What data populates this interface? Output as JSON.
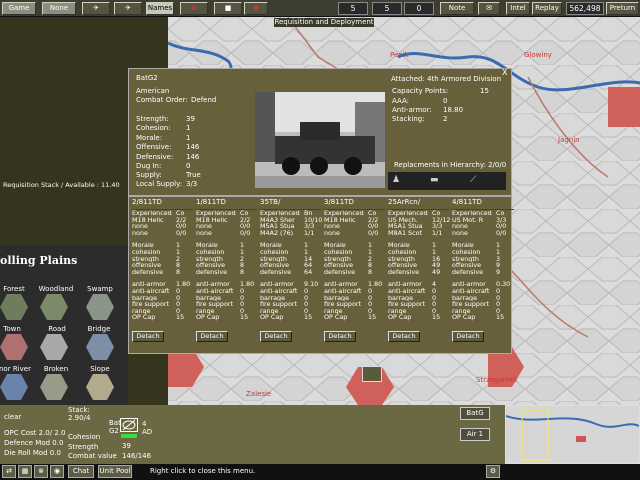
{
  "topbar": {
    "game": "Game",
    "none": "None",
    "names": "Names",
    "note": "Note",
    "intel": "Intel",
    "replay": "Replay",
    "score": "562,498",
    "preturn": "Preturn",
    "unit_count_1": "5",
    "unit_count_2": "5",
    "unit_count_3": "0"
  },
  "requisition": {
    "title": "Requisition and Deployment",
    "stack": "Requisition  Stack / Available : 11.40"
  },
  "map": {
    "towns": [
      "Penik",
      "Glowiny",
      "Jagnin",
      "Zalesie",
      "Strzegomek"
    ]
  },
  "info": {
    "unit": "BatG2",
    "nation": "American",
    "combat_order_label": "Combat Order:",
    "combat_order": "Defend",
    "stats": [
      {
        "label": "Strength:",
        "value": "39"
      },
      {
        "label": "Cohesion:",
        "value": "1"
      },
      {
        "label": "Morale:",
        "value": "1"
      },
      {
        "label": "Offensive:",
        "value": "146"
      },
      {
        "label": "Defensive:",
        "value": "146"
      },
      {
        "label": "Dug In:",
        "value": "0"
      },
      {
        "label": "Supply:",
        "value": "True"
      },
      {
        "label": "Local Supply:",
        "value": "3/3"
      }
    ],
    "attached": "Attached: 4th Armored Division",
    "right_stats": [
      {
        "label": "Capacity Points:",
        "value": "15"
      },
      {
        "label": "AAA:",
        "value": "0"
      },
      {
        "label": "Anti-armor:",
        "value": "18.80"
      },
      {
        "label": "Stacking:",
        "value": "2"
      }
    ],
    "replacements": "Replacments in Hierarchy: 2/0/0",
    "close": "X"
  },
  "units": [
    {
      "name": "2/811TD",
      "co_h": "Co",
      "eq": [
        [
          "Experienced",
          "Co"
        ],
        [
          "M18 Hellc",
          "2/2"
        ],
        [
          "none",
          "0/0"
        ],
        [
          "none",
          "0/0"
        ]
      ],
      "st": [
        [
          "Morale",
          "1"
        ],
        [
          "cohesion",
          "1"
        ],
        [
          "strength",
          "2"
        ],
        [
          "offensive",
          "8"
        ],
        [
          "defensive",
          "8"
        ]
      ],
      "cb": [
        [
          "anti-armor",
          "1.80"
        ],
        [
          "anti-aircraft",
          "0"
        ],
        [
          "barrage",
          "0"
        ],
        [
          "fire support",
          "0"
        ],
        [
          "range",
          "0"
        ],
        [
          "OP Cap",
          "15"
        ]
      ],
      "btn": "Detach"
    },
    {
      "name": "1/811TD",
      "co_h": "Co",
      "eq": [
        [
          "Experienced",
          "Co"
        ],
        [
          "M18 Hellc",
          "2/2"
        ],
        [
          "none",
          "0/0"
        ],
        [
          "none",
          "0/0"
        ]
      ],
      "st": [
        [
          "Morale",
          "1"
        ],
        [
          "cohesion",
          "1"
        ],
        [
          "strength",
          "2"
        ],
        [
          "offensive",
          "8"
        ],
        [
          "defensive",
          "8"
        ]
      ],
      "cb": [
        [
          "anti-armor",
          "1.80"
        ],
        [
          "anti-aircraft",
          "0"
        ],
        [
          "barrage",
          "0"
        ],
        [
          "fire support",
          "0"
        ],
        [
          "range",
          "0"
        ],
        [
          "OP Cap",
          "15"
        ]
      ],
      "btn": "Detach"
    },
    {
      "name": "35TB/",
      "co_h": "Bn",
      "eq": [
        [
          "Experienced",
          "Bn"
        ],
        [
          "M4A3 Sher",
          "10/10"
        ],
        [
          "M5A1 Stua",
          "3/3"
        ],
        [
          "M4A2 (76)",
          "1/1"
        ]
      ],
      "st": [
        [
          "Morale",
          "1"
        ],
        [
          "cohesion",
          "1"
        ],
        [
          "strength",
          "14"
        ],
        [
          "offensive",
          "64"
        ],
        [
          "defensive",
          "64"
        ]
      ],
      "cb": [
        [
          "anti-armor",
          "9.10"
        ],
        [
          "anti-aircraft",
          "0"
        ],
        [
          "barrage",
          "0"
        ],
        [
          "fire support",
          "0"
        ],
        [
          "range",
          "0"
        ],
        [
          "OP Cap",
          "15"
        ]
      ],
      "btn": "Detach"
    },
    {
      "name": "3/811TD",
      "co_h": "Co",
      "eq": [
        [
          "Experienced",
          "Co"
        ],
        [
          "M18 Hellc",
          "2/2"
        ],
        [
          "none",
          "0/0"
        ],
        [
          "none",
          "0/0"
        ]
      ],
      "st": [
        [
          "Morale",
          "1"
        ],
        [
          "cohesion",
          "1"
        ],
        [
          "strength",
          "2"
        ],
        [
          "offensive",
          "8"
        ],
        [
          "defensive",
          "8"
        ]
      ],
      "cb": [
        [
          "anti-armor",
          "1.80"
        ],
        [
          "anti-aircraft",
          "0"
        ],
        [
          "barrage",
          "0"
        ],
        [
          "fire support",
          "0"
        ],
        [
          "range",
          "0"
        ],
        [
          "OP Cap",
          "15"
        ]
      ],
      "btn": "Detach"
    },
    {
      "name": "25ArRcn/",
      "co_h": "Co",
      "eq": [
        [
          "Experienced",
          "Co"
        ],
        [
          "US Mech.",
          "12/12"
        ],
        [
          "M5A1 Stua",
          "3/3"
        ],
        [
          "M8A1 Scot",
          "1/1"
        ]
      ],
      "st": [
        [
          "Morale",
          "1"
        ],
        [
          "cohesion",
          "1"
        ],
        [
          "strength",
          "16"
        ],
        [
          "offensive",
          "49"
        ],
        [
          "defensive",
          "49"
        ]
      ],
      "cb": [
        [
          "anti-armor",
          "4"
        ],
        [
          "anti-aircraft",
          "0"
        ],
        [
          "barrage",
          "0"
        ],
        [
          "fire support",
          "0"
        ],
        [
          "range",
          "0"
        ],
        [
          "OP Cap",
          "15"
        ]
      ],
      "btn": "Detach"
    },
    {
      "name": "4/811TD",
      "co_h": "Co",
      "eq": [
        [
          "Experienced",
          "Co"
        ],
        [
          "US Mot. R",
          "3/3"
        ],
        [
          "none",
          "0/0"
        ],
        [
          "none",
          "0/0"
        ]
      ],
      "st": [
        [
          "Morale",
          "1"
        ],
        [
          "cohesion",
          "1"
        ],
        [
          "strength",
          "3"
        ],
        [
          "offensive",
          "9"
        ],
        [
          "defensive",
          "9"
        ]
      ],
      "cb": [
        [
          "anti-armor",
          "0.30"
        ],
        [
          "anti-aircraft",
          "0"
        ],
        [
          "barrage",
          "0"
        ],
        [
          "fire support",
          "0"
        ],
        [
          "range",
          "0"
        ],
        [
          "OP Cap",
          "15"
        ]
      ],
      "btn": "Detach"
    }
  ],
  "terrain": {
    "title": "olling Plains",
    "items": [
      "Forest",
      "Woodland",
      "Swamp",
      "Town",
      "Road",
      "Bridge",
      "inor River",
      "Broken",
      "Slope"
    ]
  },
  "bottom": {
    "clear": "clear",
    "stack_label": "Stack:",
    "stack_value": "2.90/4",
    "opc_cost": "OPC Cost   2.0/ 2.0",
    "defence_mod": "Defence Mod  0.0",
    "die_roll_mod": "Die Roll Mod  0.0",
    "cohesion": "Cohesion",
    "strength": "Strength",
    "combat_value": "Combat value",
    "unit_lbl": "Bat",
    "unit_num": "G2",
    "unit_count": "4",
    "unit_type": "AD",
    "str_val": "39",
    "cv_val": "146/146",
    "chat": "Chat",
    "unit_pool": "Unit Pool",
    "hint": "Right click to close this menu.",
    "batg": "BatG",
    "air": "Air  1"
  }
}
